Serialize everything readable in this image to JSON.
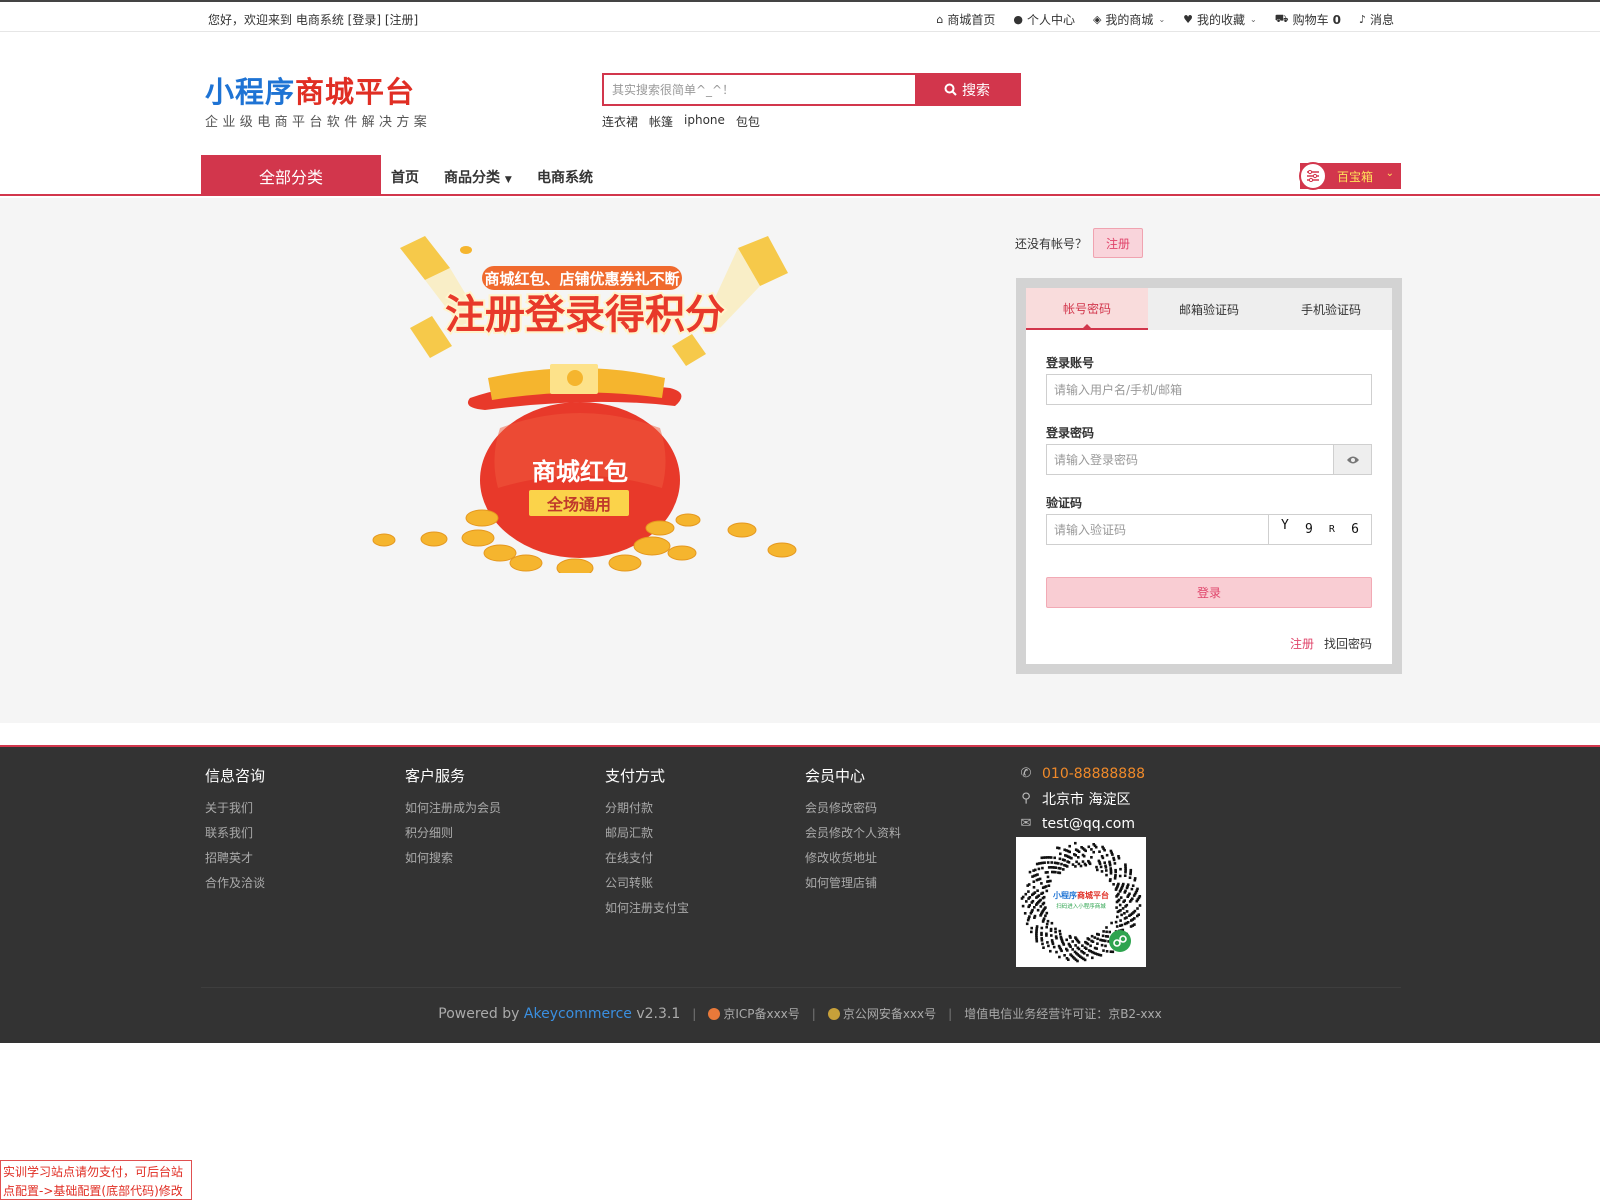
{
  "topbar": {
    "welcome": "您好，欢迎来到 电商系统",
    "login": "[登录]",
    "register": "[注册]",
    "links": [
      {
        "icon": "home-icon",
        "glyph": "⌂",
        "label": "商城首页"
      },
      {
        "icon": "user-icon",
        "glyph": "●",
        "label": "个人中心"
      },
      {
        "icon": "cube-icon",
        "glyph": "◈",
        "label": "我的商城",
        "caret": true
      },
      {
        "icon": "heart-icon",
        "glyph": "♥",
        "label": "我的收藏",
        "caret": true
      },
      {
        "icon": "cart-icon",
        "glyph": "⛟",
        "label": "购物车",
        "count": "0"
      },
      {
        "icon": "bell-icon",
        "glyph": "♪",
        "label": "消息"
      }
    ]
  },
  "header": {
    "logo_blue": "小程序",
    "logo_red": "商城平台",
    "logo_sub": "企业级电商平台软件解决方案",
    "search_placeholder": "其实搜索很简单^_^！",
    "search_button": "搜索",
    "hot_words": [
      "连衣裙",
      "帐篷",
      "iphone",
      "包包"
    ]
  },
  "nav": {
    "all_categories": "全部分类",
    "items": [
      "首页",
      "商品分类",
      "电商系统"
    ],
    "treasure": "百宝箱"
  },
  "promo": {
    "subtitle": "商城红包、店铺优惠券礼不断",
    "title": "注册登录得积分",
    "bag_title": "商城红包",
    "bag_sub": "全场通用"
  },
  "login": {
    "no_account": "还没有帐号？",
    "register_button": "注册",
    "tabs": [
      "帐号密码",
      "邮箱验证码",
      "手机验证码"
    ],
    "active_tab": 0,
    "account_label": "登录账号",
    "account_placeholder": "请输入用户名/手机/邮箱",
    "password_label": "登录密码",
    "password_placeholder": "请输入登录密码",
    "captcha_label": "验证码",
    "captcha_placeholder": "请输入验证码",
    "captcha_chars": [
      "Y",
      "9",
      "R",
      "6"
    ],
    "submit": "登录",
    "link_register": "注册",
    "link_forgot": "找回密码"
  },
  "footer": {
    "columns": [
      {
        "title": "信息咨询",
        "links": [
          "关于我们",
          "联系我们",
          "招聘英才",
          "合作及洽谈"
        ]
      },
      {
        "title": "客户服务",
        "links": [
          "如何注册成为会员",
          "积分细则",
          "如何搜索"
        ]
      },
      {
        "title": "支付方式",
        "links": [
          "分期付款",
          "邮局汇款",
          "在线支付",
          "公司转账",
          "如何注册支付宝"
        ]
      },
      {
        "title": "会员中心",
        "links": [
          "会员修改密码",
          "会员修改个人资料",
          "修改收货地址",
          "如何管理店铺"
        ]
      }
    ],
    "phone": "010-88888888",
    "address": "北京市 海淀区",
    "email": "test@qq.com",
    "qr_title_blue": "小程序",
    "qr_title_red": "商城平台",
    "qr_line": "扫码进入小程序商城",
    "powered_prefix": "Powered by",
    "brand": "Akeycommerce",
    "version": "v2.3.1",
    "icp": "京ICP备xxx号",
    "police": "京公网安备xxx号",
    "license": "增值电信业务经营许可证：京B2-xxx"
  },
  "notice": "实训学习站点请勿支付，可后台站点配置->基础配置(底部代码)修改",
  "colors": {
    "brand_red": "#d2364c",
    "logo_blue": "#1e73d4",
    "footer_bg": "#333333",
    "phone_orange": "#f08a2a"
  }
}
